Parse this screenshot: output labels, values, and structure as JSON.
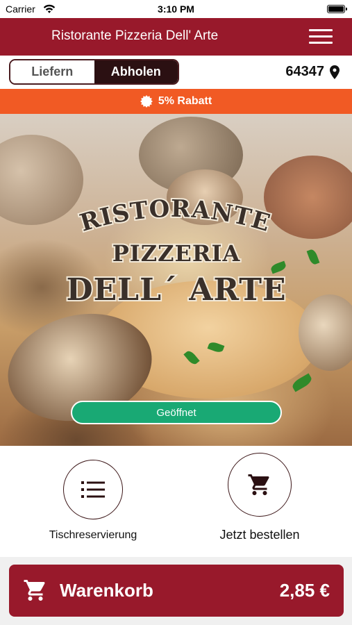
{
  "status_bar": {
    "carrier": "Carrier",
    "time": "3:10 PM"
  },
  "header": {
    "title": "Ristorante Pizzeria Dell' Arte",
    "menu_icon": "hamburger-menu-icon"
  },
  "mode_toggle": {
    "deliver_label": "Liefern",
    "pickup_label": "Abholen",
    "selected": "Abholen"
  },
  "location": {
    "postal_code": "64347",
    "icon": "location-pin-icon"
  },
  "discount": {
    "text": "5% Rabatt",
    "icon": "badge-icon"
  },
  "hero": {
    "logo_line1": "RISTORANTE",
    "logo_line2": "PIZZERIA",
    "logo_line3": "DELL´ ARTE",
    "status_label": "Geöffnet"
  },
  "actions": {
    "reservation_label": "Tischreservierung",
    "reservation_icon": "list-icon",
    "order_label": "Jetzt bestellen",
    "order_icon": "cart-icon"
  },
  "cart": {
    "label": "Warenkorb",
    "total": "2,85 €",
    "icon": "cart-icon"
  },
  "colors": {
    "primary": "#98192b",
    "accent": "#f15a24",
    "open_status": "#19a974",
    "dark": "#2b1012"
  }
}
